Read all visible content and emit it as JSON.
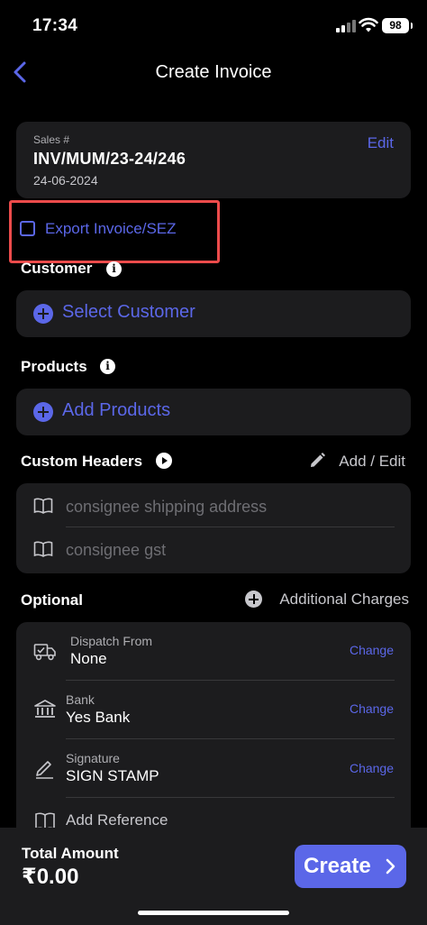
{
  "status_bar": {
    "time": "17:34",
    "battery": "98"
  },
  "nav": {
    "title": "Create Invoice"
  },
  "sales": {
    "label": "Sales #",
    "number": "INV/MUM/23-24/246",
    "date": "24-06-2024",
    "edit_label": "Edit"
  },
  "export": {
    "label": "Export Invoice/SEZ",
    "checked": false
  },
  "customer": {
    "label": "Customer",
    "action": "Select Customer"
  },
  "products": {
    "label": "Products",
    "action": "Add Products"
  },
  "custom_headers": {
    "label": "Custom Headers",
    "add_edit_label": "Add / Edit",
    "fields": [
      {
        "placeholder": "consignee shipping address"
      },
      {
        "placeholder": "consignee gst"
      }
    ]
  },
  "optional": {
    "label": "Optional",
    "additional_charges_label": "Additional Charges",
    "items": [
      {
        "label": "Dispatch From",
        "value": "None",
        "action": "Change",
        "icon": "truck-icon"
      },
      {
        "label": "Bank",
        "value": "Yes Bank",
        "action": "Change",
        "icon": "bank-icon"
      },
      {
        "label": "Signature",
        "value": "SIGN STAMP",
        "action": "Change",
        "icon": "signature-icon"
      },
      {
        "label": "",
        "value": "Add Reference",
        "action": "",
        "icon": "book-icon"
      }
    ]
  },
  "footer": {
    "total_label": "Total Amount",
    "total_value": "₹0.00",
    "create_label": "Create"
  },
  "colors": {
    "accent": "#5b67e8",
    "highlight": "#ec4b4b",
    "card": "#1c1c1e",
    "background": "#000000"
  }
}
